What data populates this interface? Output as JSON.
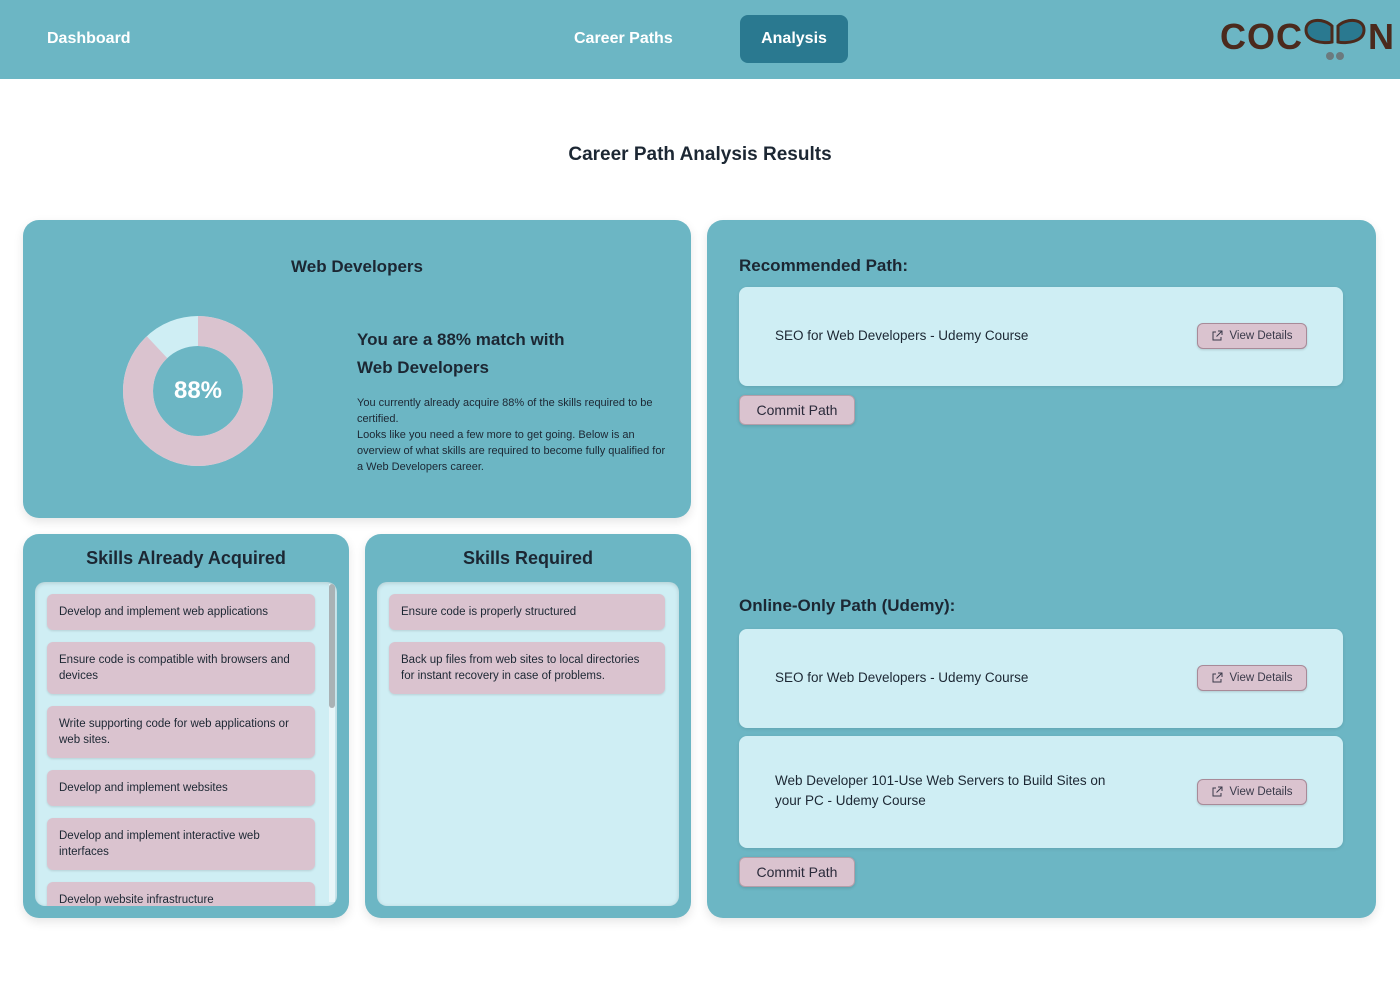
{
  "nav": {
    "dashboard": "Dashboard",
    "career_paths": "Career Paths",
    "analysis": "Analysis",
    "logo_left": "COC",
    "logo_right": "N",
    "active_color": "#2a7990",
    "bar_color": "#6cb6c4"
  },
  "page_title": "Career Path Analysis Results",
  "match": {
    "career": "Web Developers",
    "percent_label": "88%",
    "percent_value": 88,
    "headline_line1": "You are a 88% match with",
    "headline_line2": "Web Developers",
    "desc_line1": "You currently already acquire 88% of the skills required to be certified.",
    "desc_line2": "Looks like you need a few more to get going. Below is an overview of what skills are required to become fully qualified for a Web Developers career.",
    "ring_color": "#dac3cf",
    "ring_remaining_color": "#cfeef4"
  },
  "skills_acquired": {
    "title": "Skills Already Acquired",
    "items": [
      "Develop and implement web applications",
      "Ensure code is compatible with browsers and devices",
      "Write supporting code for web applications or web sites.",
      "Develop and implement websites",
      "Develop and implement interactive web interfaces",
      "Develop website infrastructure"
    ]
  },
  "skills_required": {
    "title": "Skills Required",
    "items": [
      "Ensure code is properly structured",
      "Back up files from web sites to local directories for instant recovery in case of problems."
    ]
  },
  "recommended": {
    "title": "Recommended Path:",
    "courses": [
      {
        "name": "SEO for Web Developers - Udemy Course",
        "button": "View Details"
      }
    ],
    "commit": "Commit Path"
  },
  "online_only": {
    "title": "Online-Only Path (Udemy):",
    "courses": [
      {
        "name": "SEO for Web Developers - Udemy Course",
        "button": "View Details"
      },
      {
        "name": "Web Developer 101-Use Web Servers to Build Sites on your PC - Udemy Course",
        "button": "View Details"
      }
    ],
    "commit": "Commit Path"
  }
}
